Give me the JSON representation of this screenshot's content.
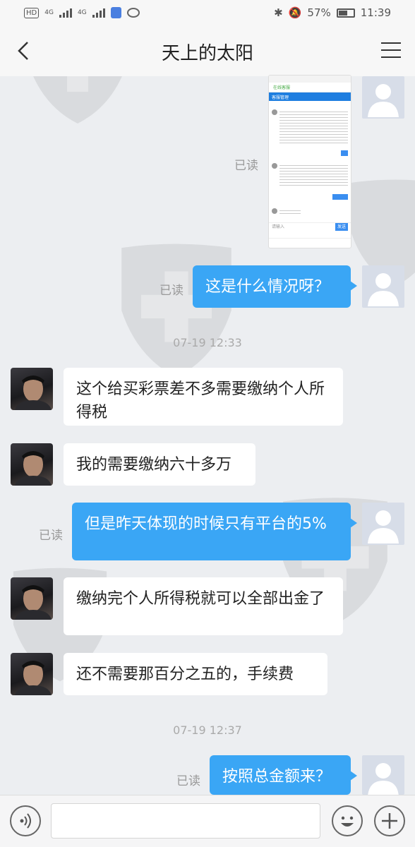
{
  "status_bar": {
    "hd": "HD",
    "net1": "4G",
    "net2": "4G",
    "battery": "57%",
    "time": "11:39"
  },
  "header": {
    "title": "天上的太阳"
  },
  "read_label": "已读",
  "messages": [
    {
      "side": "out",
      "type": "image",
      "read": "已读"
    },
    {
      "side": "out",
      "text": "这是什么情况呀？",
      "read": "已读"
    },
    {
      "type": "time",
      "text": "07-19 12:33"
    },
    {
      "side": "in",
      "text": "这个给买彩票差不多需要缴纳个人所得税"
    },
    {
      "side": "in",
      "text": "我的需要缴纳六十多万"
    },
    {
      "side": "out",
      "text": "但是昨天体现的时候只有平台的5%",
      "read": "已读"
    },
    {
      "side": "in",
      "text": "缴纳完个人所得税就可以全部出金了"
    },
    {
      "side": "in",
      "text": "还不需要那百分之五的，手续费"
    },
    {
      "type": "time",
      "text": "07-19 12:37"
    },
    {
      "side": "out",
      "text": "按照总金额来？",
      "read": "已读"
    }
  ],
  "embedded_shot": {
    "title": "客服管理",
    "tab": "在线客服",
    "send_label": "发送",
    "input_placeholder": "请输入"
  },
  "input_bar": {
    "placeholder": ""
  },
  "colors": {
    "bubble_out": "#3aa6f5",
    "bubble_in": "#ffffff",
    "background": "#eceef1"
  }
}
